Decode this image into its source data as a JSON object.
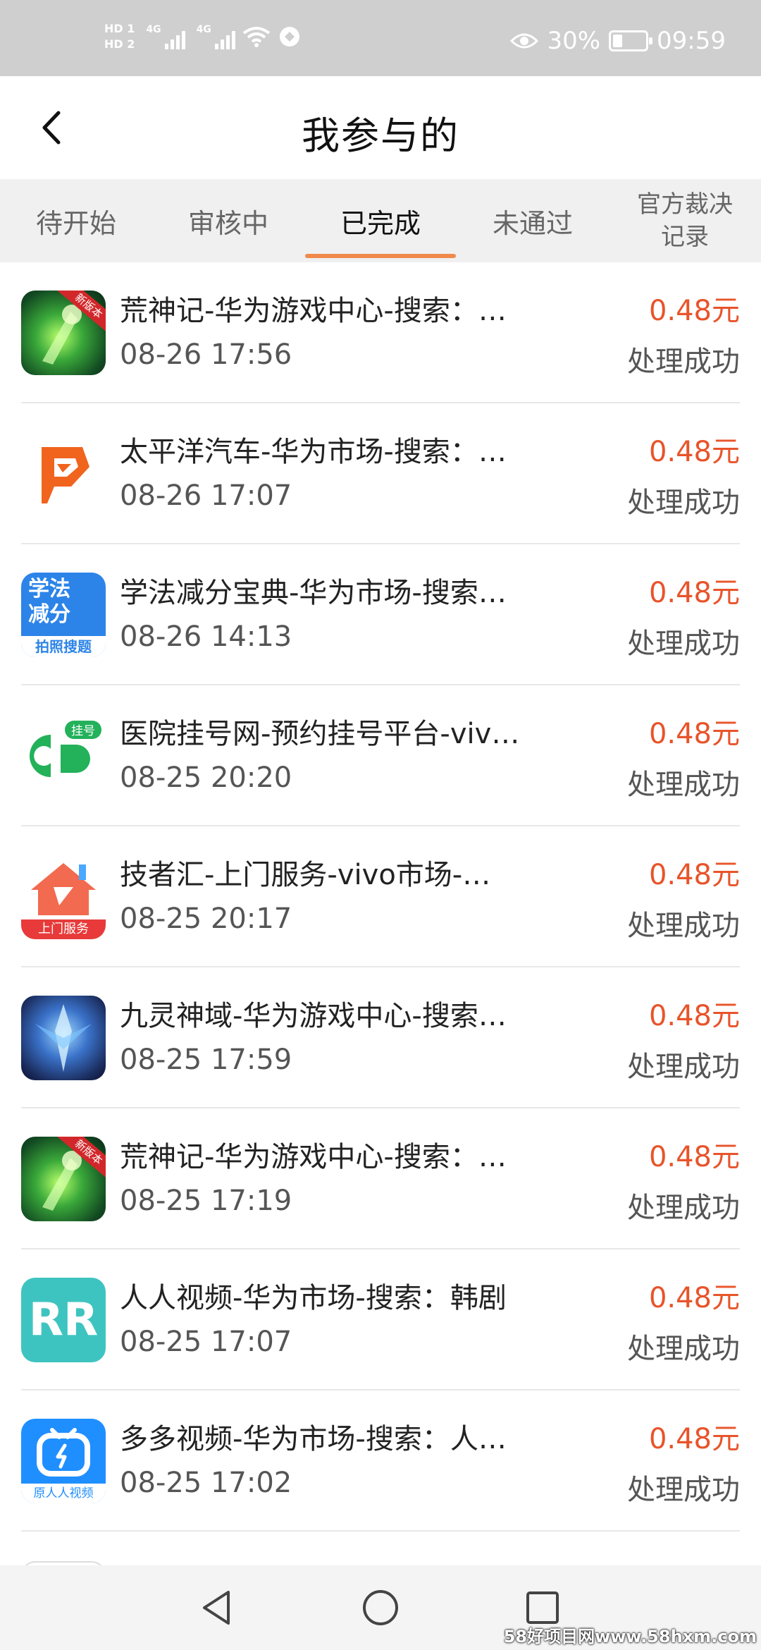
{
  "status_bar": {
    "hd1": "HD 1",
    "hd2": "HD 2",
    "sig1": "4G",
    "sig2": "4G",
    "battery_percent_text": "30%",
    "battery_level": 0.3,
    "time": "09:59"
  },
  "header": {
    "title": "我参与的",
    "back_icon": "chevron-left-icon"
  },
  "tabs": [
    {
      "label": "待开始",
      "active": false
    },
    {
      "label": "审核中",
      "active": false
    },
    {
      "label": "已完成",
      "active": true
    },
    {
      "label": "未通过",
      "active": false
    },
    {
      "label_line1": "官方裁决",
      "label_line2": "记录",
      "active": false
    }
  ],
  "items": [
    {
      "title": "荒神记-华为游戏中心-搜索：…",
      "time": "08-26 17:56",
      "amount": "0.48元",
      "status": "处理成功",
      "icon": "game-icon",
      "icon_badge": "新版本"
    },
    {
      "title": "太平洋汽车-华为市场-搜索：…",
      "time": "08-26 17:07",
      "amount": "0.48元",
      "status": "处理成功",
      "icon": "taiping-logo-icon"
    },
    {
      "title": "学法减分宝典-华为市场-搜索…",
      "time": "08-26 14:13",
      "amount": "0.48元",
      "status": "处理成功",
      "icon": "xuefa-icon",
      "icon_text1": "学法",
      "icon_text2": "减分",
      "icon_text3": "拍照搜题"
    },
    {
      "title": "医院挂号网-预约挂号平台-viv…",
      "time": "08-25 20:20",
      "amount": "0.48元",
      "status": "处理成功",
      "icon": "hospital-icon",
      "icon_badge": "挂号"
    },
    {
      "title": "技者汇-上门服务-vivo市场-…",
      "time": "08-25 20:17",
      "amount": "0.48元",
      "status": "处理成功",
      "icon": "jizhe-icon",
      "icon_text": "上门服务"
    },
    {
      "title": "九灵神域-华为游戏中心-搜索…",
      "time": "08-25 17:59",
      "amount": "0.48元",
      "status": "处理成功",
      "icon": "game2-icon"
    },
    {
      "title": "荒神记-华为游戏中心-搜索：…",
      "time": "08-25 17:19",
      "amount": "0.48元",
      "status": "处理成功",
      "icon": "game-icon",
      "icon_badge": "新版本"
    },
    {
      "title": "人人视频-华为市场-搜索：韩剧",
      "time": "08-25 17:07",
      "amount": "0.48元",
      "status": "处理成功",
      "icon": "renren-icon",
      "icon_text": "RR"
    },
    {
      "title": "多多视频-华为市场-搜索：人…",
      "time": "08-25 17:02",
      "amount": "0.48元",
      "status": "处理成功",
      "icon": "duoduo-icon",
      "icon_text": "原人人视频"
    }
  ],
  "navbar": {
    "back": "triangle-back-icon",
    "home": "circle-home-icon",
    "recents": "square-recents-icon"
  },
  "watermark": "58好项目网www.58hxm.com",
  "colors": {
    "accent": "#f08a4b",
    "amount": "#e8542a",
    "status_bar": "#cfcfcf",
    "tab_bg": "#f0f0f0"
  }
}
